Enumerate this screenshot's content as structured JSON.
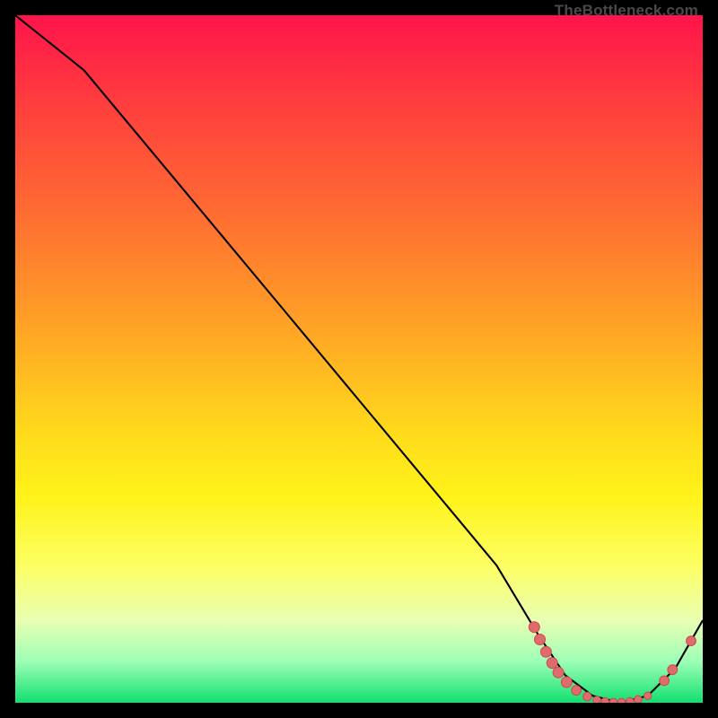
{
  "watermark": "TheBottleneck.com",
  "colors": {
    "bg": "#000000",
    "grad_top": "#ff144b",
    "grad_bottom": "#11e06f",
    "curve": "#000000",
    "dot_fill": "#e06a6c",
    "dot_stroke": "#c94a4f"
  },
  "chart_data": {
    "type": "line",
    "title": "",
    "xlabel": "",
    "ylabel": "",
    "xlim": [
      0,
      100
    ],
    "ylim": [
      0,
      100
    ],
    "series": [
      {
        "name": "bottleneck-curve",
        "x": [
          0,
          5,
          10,
          20,
          30,
          40,
          50,
          60,
          70,
          76,
          80,
          84,
          88,
          92,
          96,
          100
        ],
        "y": [
          100,
          96,
          92,
          80,
          68,
          56,
          44,
          32,
          20,
          10,
          4,
          1,
          0,
          1,
          5,
          12
        ]
      }
    ],
    "annotations": {
      "dots": [
        {
          "x": 75.5,
          "y": 11.0,
          "r": 1.0
        },
        {
          "x": 76.3,
          "y": 9.2,
          "r": 1.0
        },
        {
          "x": 77.2,
          "y": 7.4,
          "r": 1.0
        },
        {
          "x": 78.1,
          "y": 5.8,
          "r": 1.0
        },
        {
          "x": 79.0,
          "y": 4.4,
          "r": 1.0
        },
        {
          "x": 80.2,
          "y": 3.0,
          "r": 1.0
        },
        {
          "x": 81.6,
          "y": 1.8,
          "r": 0.9
        },
        {
          "x": 83.2,
          "y": 0.9,
          "r": 0.8
        },
        {
          "x": 84.6,
          "y": 0.4,
          "r": 0.7
        },
        {
          "x": 85.8,
          "y": 0.2,
          "r": 0.7
        },
        {
          "x": 87.0,
          "y": 0.1,
          "r": 0.7
        },
        {
          "x": 88.2,
          "y": 0.1,
          "r": 0.7
        },
        {
          "x": 89.4,
          "y": 0.2,
          "r": 0.7
        },
        {
          "x": 90.6,
          "y": 0.5,
          "r": 0.7
        },
        {
          "x": 92.0,
          "y": 1.0,
          "r": 0.7
        },
        {
          "x": 94.4,
          "y": 3.2,
          "r": 0.9
        },
        {
          "x": 95.6,
          "y": 4.8,
          "r": 0.9
        },
        {
          "x": 98.3,
          "y": 9.0,
          "r": 0.9
        }
      ]
    }
  }
}
